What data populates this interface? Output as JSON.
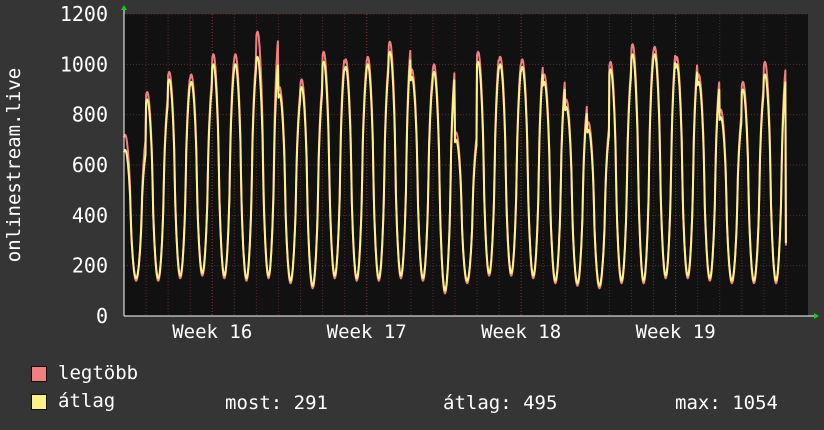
{
  "colors": {
    "background": "#353535",
    "plot_bg": "#111111",
    "grid": "#5a2a2a",
    "max_series": "#f07f7f",
    "avg_series": "#fdf28a",
    "text": "#ffffff"
  },
  "chart_data": {
    "type": "line",
    "ylabel": "onlinestream.live",
    "ylim": [
      0,
      1200
    ],
    "yticks": [
      "0",
      "200",
      "400",
      "600",
      "800",
      "1000",
      "1200"
    ],
    "x_labels": [
      "Week 16",
      "Week 17",
      "Week 18",
      "Week 19"
    ],
    "x_label_days": [
      4,
      11,
      18,
      25
    ],
    "xlim_days": [
      0,
      31
    ],
    "grid": true,
    "series": [
      {
        "name": "legtöbb",
        "color": "#f07f7f",
        "peaks": [
          720,
          890,
          970,
          960,
          1040,
          1040,
          1130,
          910,
          940,
          1050,
          1020,
          1030,
          1090,
          980,
          1000,
          730,
          1050,
          1030,
          1020,
          960,
          860,
          770,
          1010,
          1080,
          1070,
          1030,
          960,
          820,
          930,
          1010
        ],
        "troughs": [
          140,
          140,
          150,
          160,
          150,
          140,
          150,
          130,
          110,
          150,
          140,
          140,
          150,
          140,
          90,
          130,
          160,
          160,
          150,
          130,
          120,
          110,
          130,
          130,
          150,
          150,
          140,
          130,
          130,
          130
        ]
      },
      {
        "name": "átlag",
        "color": "#fdf28a",
        "peaks": [
          660,
          860,
          940,
          930,
          1000,
          1000,
          1030,
          880,
          910,
          1010,
          990,
          1000,
          1050,
          950,
          970,
          700,
          1010,
          1000,
          990,
          930,
          830,
          740,
          980,
          1040,
          1040,
          1000,
          930,
          790,
          900,
          960
        ],
        "troughs": [
          150,
          150,
          160,
          170,
          160,
          150,
          160,
          140,
          120,
          160,
          150,
          150,
          160,
          150,
          100,
          140,
          170,
          170,
          160,
          140,
          130,
          120,
          140,
          140,
          160,
          160,
          150,
          140,
          140,
          140
        ]
      }
    ]
  },
  "legend": {
    "items": [
      {
        "label": "legtöbb",
        "color": "#f07f7f"
      },
      {
        "label": "átlag",
        "color": "#fdf28a"
      }
    ],
    "stats": {
      "now": "most: 291",
      "avg": "átlag: 495",
      "max": "max: 1054"
    }
  }
}
